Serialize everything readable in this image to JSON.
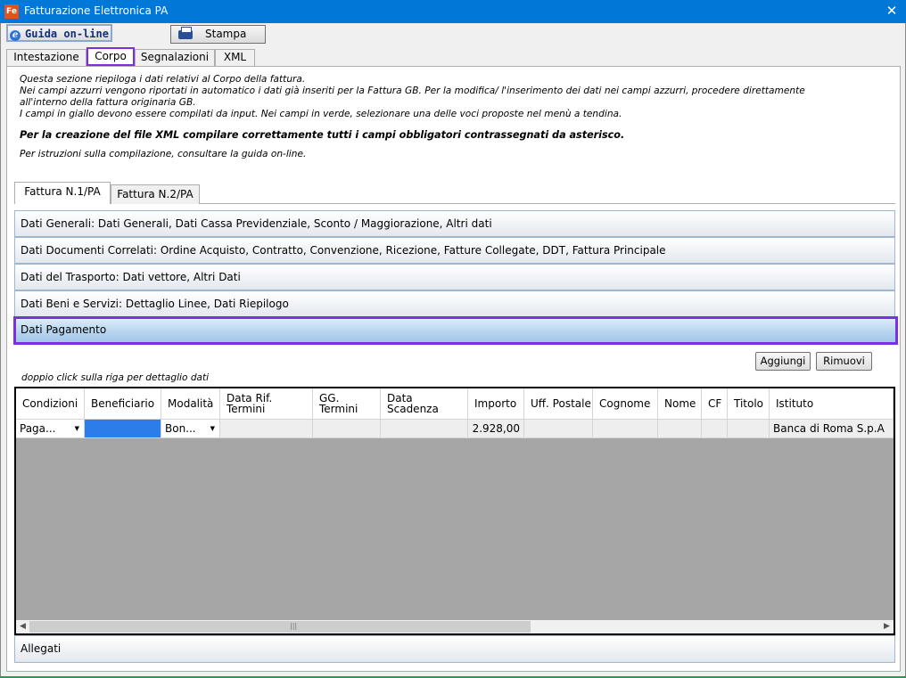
{
  "window": {
    "title": "Fatturazione Elettronica PA",
    "app_icon": "Fe",
    "close_glyph": "✕"
  },
  "toolbar": {
    "guida_label": "Guida on-line",
    "stampa_label": "Stampa"
  },
  "top_tabs": [
    "Intestazione",
    "Corpo",
    "Segnalazioni",
    "XML"
  ],
  "active_top_tab": "Corpo",
  "intro": {
    "line1": "Questa sezione riepiloga i dati relativi al Corpo della fattura.",
    "line2": "Nei campi azzurri vengono riportati in automatico i dati già inseriti per la Fattura GB. Per la modifica/ l'inserimento dei dati nei campi azzurri, procedere direttamente",
    "line3": "all'interno della fattura originaria GB.",
    "line4": "I campi in giallo devono essere compilati da input. Nei campi in verde, selezionare una delle voci proposte nel menù a tendina.",
    "bold": "Per la creazione del file XML compilare correttamente tutti i campi obbligatori contrassegnati da asterisco.",
    "istruzioni": "Per istruzioni sulla compilazione, consultare la guida on-line."
  },
  "sub_tabs": [
    "Fattura N.1/PA",
    "Fattura N.2/PA"
  ],
  "active_sub_tab": "Fattura N.1/PA",
  "sections": [
    "Dati Generali: Dati Generali, Dati Cassa Previdenziale, Sconto / Maggiorazione, Altri dati",
    "Dati Documenti Correlati: Ordine Acquisto, Contratto, Convenzione, Ricezione, Fatture Collegate, DDT, Fattura Principale",
    "Dati del Trasporto: Dati vettore, Altri Dati",
    "Dati Beni e Servizi: Dettaglio Linee, Dati Riepilogo",
    "Dati Pagamento"
  ],
  "active_section": "Dati Pagamento",
  "hint": "doppio click sulla riga per dettaglio dati",
  "buttons": {
    "aggiungi": "Aggiungi",
    "rimuovi": "Rimuovi"
  },
  "grid": {
    "columns": [
      "Condizioni",
      "Beneficiario",
      "Modalità",
      "Data Rif. Termini",
      "GG. Termini",
      "Data Scadenza",
      "Importo",
      "Uff. Postale",
      "Cognome",
      "Nome",
      "CF",
      "Titolo",
      "Istituto"
    ],
    "rows": [
      [
        "Paga...",
        "",
        "Bon...",
        "",
        "",
        "",
        "2.928,00",
        "",
        "",
        "",
        "",
        "",
        "Banca di Roma S.p.A"
      ]
    ],
    "dropdown_glyph": "▼",
    "scroll_left": "◀",
    "scroll_right": "▶",
    "scroll_grip": "|||"
  },
  "allegati": "Allegati"
}
